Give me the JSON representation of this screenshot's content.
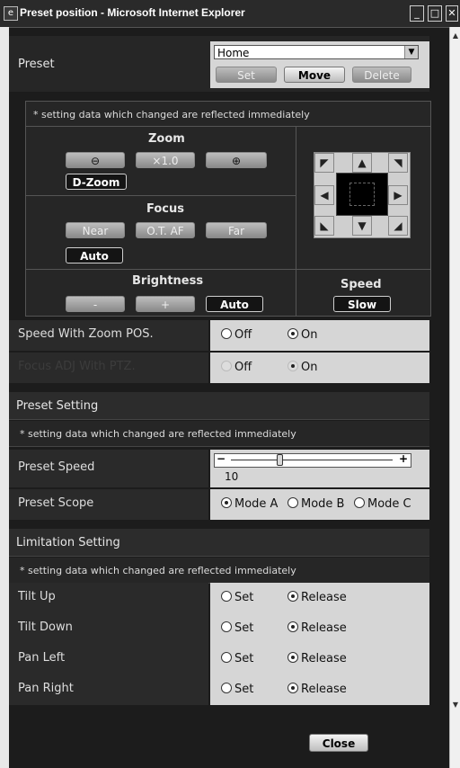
{
  "window": {
    "title": "Preset position - Microsoft Internet Explorer",
    "app_icon": "ie-icon",
    "controls": {
      "minimize": "minimize-icon",
      "maximize": "maximize-icon",
      "close": "close-icon"
    }
  },
  "preset": {
    "label": "Preset",
    "selected": "Home",
    "buttons": {
      "set": "Set",
      "move": "Move",
      "delete": "Delete"
    }
  },
  "camera": {
    "note": "* setting data which changed are reflected immediately",
    "zoom": {
      "title": "Zoom",
      "zoom_out_icon": "zoom-out-icon",
      "ratio": "×1.0",
      "zoom_in_icon": "zoom-in-icon",
      "dzoom": "D-Zoom"
    },
    "focus": {
      "title": "Focus",
      "near": "Near",
      "otaf": "O.T. AF",
      "far": "Far",
      "auto": "Auto"
    },
    "brightness": {
      "title": "Brightness",
      "minus": "-",
      "plus": "+",
      "auto": "Auto"
    },
    "speed": {
      "title": "Speed",
      "value": "Slow"
    },
    "ptz_pad": {
      "up": "up-arrow-icon",
      "down": "down-arrow-icon",
      "left": "left-arrow-icon",
      "right": "right-arrow-icon"
    }
  },
  "options": [
    {
      "label": "Speed With Zoom POS.",
      "off": "Off",
      "on": "On",
      "selected": "On"
    },
    {
      "label": "Focus ADJ With PTZ.",
      "off": "Off",
      "on": "On",
      "selected": "On"
    }
  ],
  "preset_setting": {
    "title": "Preset Setting",
    "note": "* setting data which changed are reflected immediately",
    "speed_label": "Preset Speed",
    "speed_value": "10",
    "slider_minus": "−",
    "slider_plus": "+",
    "slider_fraction": 0.3,
    "scope_label": "Preset Scope",
    "scope_options": [
      "Mode A",
      "Mode B",
      "Mode C"
    ],
    "scope_selected": "Mode A"
  },
  "limitation": {
    "title": "Limitation Setting",
    "note": "* setting data which changed are reflected immediately",
    "rows": [
      {
        "label": "Tilt Up",
        "set": "Set",
        "release": "Release",
        "selected": "Release"
      },
      {
        "label": "Tilt Down",
        "set": "Set",
        "release": "Release",
        "selected": "Release"
      },
      {
        "label": "Pan Left",
        "set": "Set",
        "release": "Release",
        "selected": "Release"
      },
      {
        "label": "Pan Right",
        "set": "Set",
        "release": "Release",
        "selected": "Release"
      }
    ]
  },
  "close_label": "Close"
}
